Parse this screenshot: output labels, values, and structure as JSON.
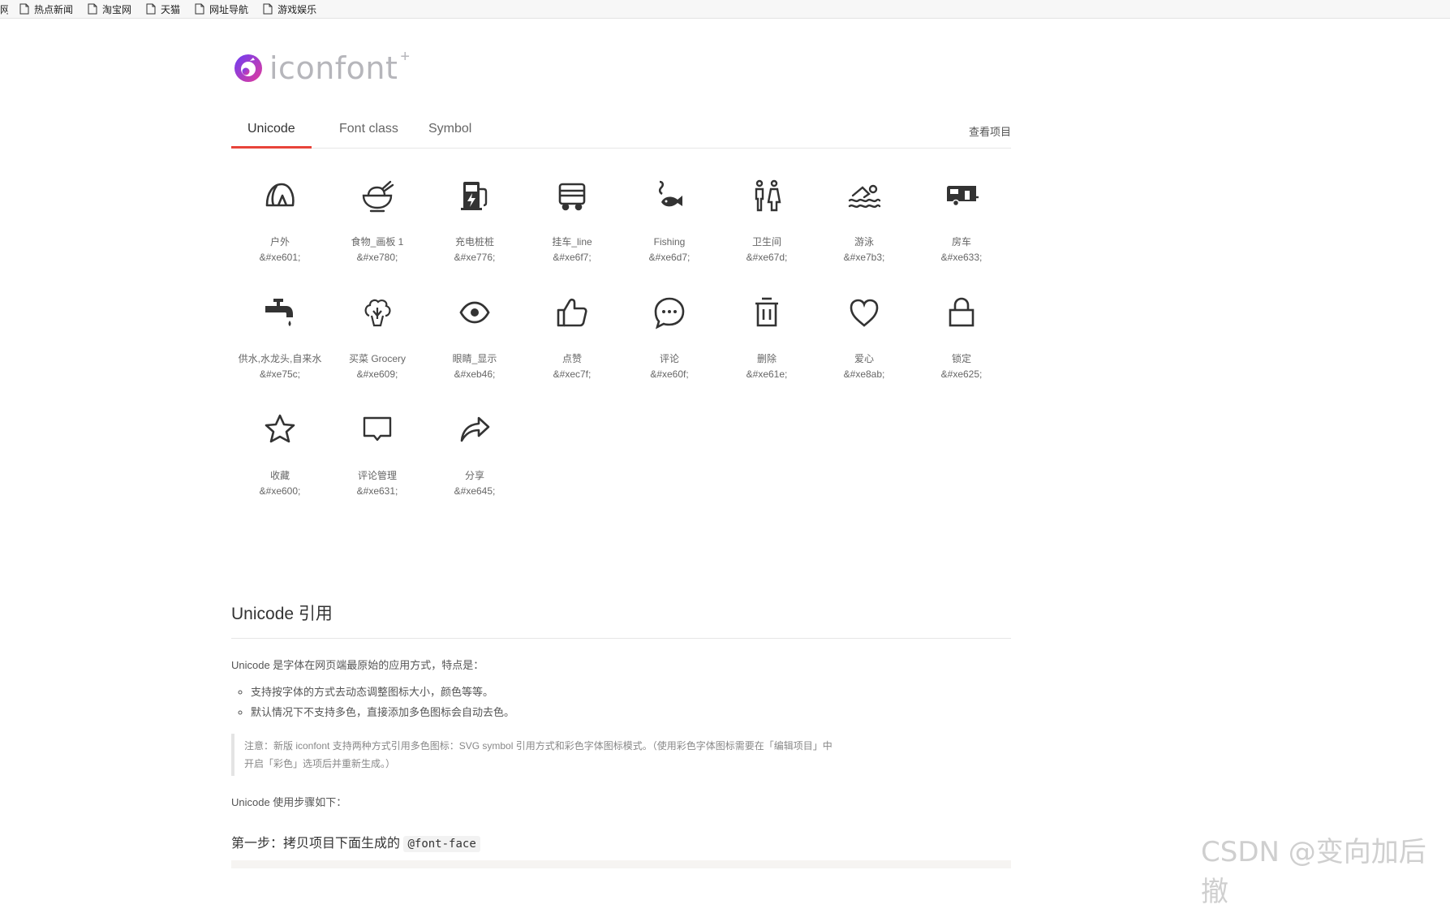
{
  "bookmarks": [
    "热点新闻",
    "淘宝网",
    "天猫",
    "网址导航",
    "游戏娱乐"
  ],
  "logo": {
    "text": "iconfont",
    "plus": "+"
  },
  "tabs": [
    "Unicode",
    "Font class",
    "Symbol"
  ],
  "view_project": "查看项目",
  "icons": [
    {
      "name": "户外",
      "code": "&#xe601;",
      "icon": "tent-icon"
    },
    {
      "name": "食物_画板 1",
      "code": "&#xe780;",
      "icon": "food-bowl-icon"
    },
    {
      "name": "充电桩桩",
      "code": "&#xe776;",
      "icon": "charging-station-icon"
    },
    {
      "name": "挂车_line",
      "code": "&#xe6f7;",
      "icon": "trailer-icon"
    },
    {
      "name": "Fishing",
      "code": "&#xe6d7;",
      "icon": "fishing-icon"
    },
    {
      "name": "卫生间",
      "code": "&#xe67d;",
      "icon": "restroom-icon"
    },
    {
      "name": "游泳",
      "code": "&#xe7b3;",
      "icon": "swimming-icon"
    },
    {
      "name": "房车",
      "code": "&#xe633;",
      "icon": "rv-icon"
    },
    {
      "name": "供水,水龙头,自来水",
      "code": "&#xe75c;",
      "icon": "faucet-icon"
    },
    {
      "name": "买菜 Grocery",
      "code": "&#xe609;",
      "icon": "grocery-icon"
    },
    {
      "name": "眼睛_显示",
      "code": "&#xeb46;",
      "icon": "eye-icon"
    },
    {
      "name": "点赞",
      "code": "&#xec7f;",
      "icon": "thumbs-up-icon"
    },
    {
      "name": "评论",
      "code": "&#xe60f;",
      "icon": "comment-icon"
    },
    {
      "name": "删除",
      "code": "&#xe61e;",
      "icon": "trash-icon"
    },
    {
      "name": "爱心",
      "code": "&#xe8ab;",
      "icon": "heart-icon"
    },
    {
      "name": "锁定",
      "code": "&#xe625;",
      "icon": "lock-icon"
    },
    {
      "name": "收藏",
      "code": "&#xe600;",
      "icon": "star-icon"
    },
    {
      "name": "评论管理",
      "code": "&#xe631;",
      "icon": "chat-box-icon"
    },
    {
      "name": "分享",
      "code": "&#xe645;",
      "icon": "share-icon"
    }
  ],
  "article": {
    "title": "Unicode 引用",
    "intro": "Unicode 是字体在网页端最原始的应用方式，特点是：",
    "bullets": [
      "支持按字体的方式去动态调整图标大小，颜色等等。",
      "默认情况下不支持多色，直接添加多色图标会自动去色。"
    ],
    "note_line1": "注意：新版 iconfont 支持两种方式引用多色图标：SVG symbol 引用方式和彩色字体图标模式。（使用彩色字体图标需要在「编辑项目」中",
    "note_line2": "开启「彩色」选项后并重新生成。）",
    "steps_intro": "Unicode 使用步骤如下：",
    "step1": "第一步：拷贝项目下面生成的",
    "step1_code": "@font-face"
  },
  "watermark": "CSDN @变向加后撤",
  "colors": {
    "accent": "#e8443a",
    "icon": "#333333",
    "logo_gradient": [
      "#6c3df4",
      "#e33c9b"
    ]
  }
}
